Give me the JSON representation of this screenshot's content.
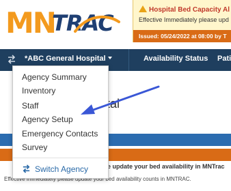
{
  "header": {
    "logo": {
      "mn": "MN",
      "trac": "TRAC"
    },
    "alert": {
      "title": "Hospital Bed Capacity Al",
      "body": "Effective Immediately please upd",
      "issued": "Issued: 05/24/2022 at 08:00 by T"
    }
  },
  "navbar": {
    "hospital": "*ABC General Hospital",
    "availability": "Availability Status",
    "partial": "Patie"
  },
  "dropdown": {
    "items": [
      "Agency Summary",
      "Inventory",
      "Staff",
      "Agency Setup",
      "Emergency Contacts",
      "Survey"
    ],
    "switch_label": "Switch Agency"
  },
  "page": {
    "title_fragment": "ital",
    "notice_bold": "se update your bed availability in MNTrac",
    "notice_line": "Effective Immediately please update your bed availability counts in MNTRAC."
  },
  "colors": {
    "navbar": "#1f3f5f",
    "brand_orange": "#f39a1e",
    "brand_navy": "#1f3f73",
    "link_blue": "#2a6aa8",
    "arrow": "#3a57d6",
    "alert_bg": "#fff6cc",
    "alert_issued": "#d96b16"
  }
}
